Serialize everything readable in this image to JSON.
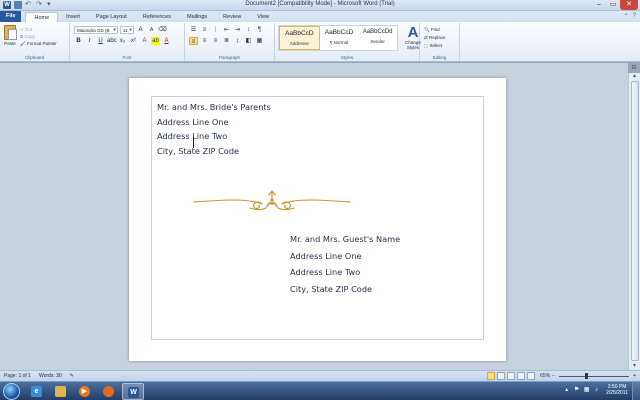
{
  "window": {
    "title": "Document2 [Compatibility Mode] - Microsoft Word (Trial)",
    "minimize": "–",
    "maximize": "▭",
    "close": "✕"
  },
  "qat": {
    "app_icon": "W",
    "undo": "↶",
    "redo": "↷",
    "more": "▾"
  },
  "tabs": [
    {
      "label": "File"
    },
    {
      "label": "Home"
    },
    {
      "label": "Insert"
    },
    {
      "label": "Page Layout"
    },
    {
      "label": "References"
    },
    {
      "label": "Mailings"
    },
    {
      "label": "Review"
    },
    {
      "label": "View"
    }
  ],
  "ribbon": {
    "clipboard": {
      "paste": "Paste",
      "cut": "Cut",
      "copy": "Copy",
      "format_painter": "Format Painter",
      "label": "Clipboard"
    },
    "font": {
      "name": "Maiandra GD (B",
      "size": "11",
      "grow": "A",
      "shrink": "A",
      "bold": "B",
      "italic": "I",
      "underline": "U",
      "label": "Font"
    },
    "paragraph": {
      "label": "Paragraph",
      "pilcrow": "¶"
    },
    "styles": {
      "items": [
        {
          "preview": "AaBbCcD",
          "name": "Addresse"
        },
        {
          "preview": "AaBbCcD",
          "name": "¶ Normal"
        },
        {
          "preview": "AaBbCcDd",
          "name": "Sender"
        }
      ],
      "change_styles": "Change Styles",
      "label": "Styles"
    },
    "editing": {
      "find": "Find",
      "replace": "Replace",
      "select": "Select",
      "label": "Editing"
    }
  },
  "document": {
    "sender": [
      "Mr. and Mrs. Bride's Parents",
      "Address Line One",
      "Address Line Two",
      "City, State  ZIP Code"
    ],
    "recipient": [
      "Mr. and Mrs. Guest's Name",
      "Address Line One",
      "Address Line Two",
      "City, State  ZIP Code"
    ]
  },
  "statusbar": {
    "page": "Page: 1 of 1",
    "words": "Words: 30",
    "zoom": "65%",
    "zoom_minus": "−",
    "zoom_plus": "+"
  },
  "taskbar": {
    "time": "3:50 PM",
    "date": "2/25/2011",
    "word_icon": "W"
  },
  "colors": {
    "ornament": "#c8962e",
    "text": "#25344d",
    "file_tab": "#2b579a"
  }
}
